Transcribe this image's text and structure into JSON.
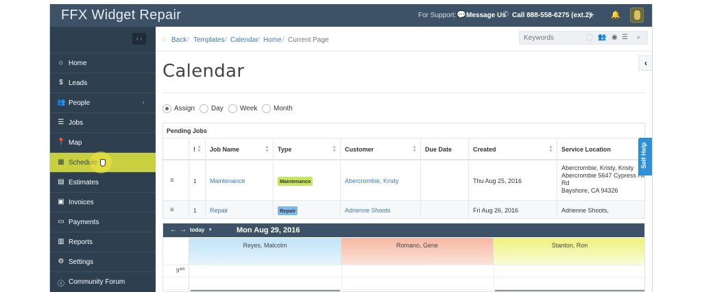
{
  "app": {
    "brand": "FFX Widget Repair"
  },
  "topbar": {
    "support_label": "For Support:",
    "message_label": "Message Us",
    "call_label": "Call 888-558-6275 (ext.2)",
    "plus_icon": "+",
    "bell_icon": "🔔"
  },
  "sidebar": {
    "toggle_label": "‹ ›",
    "items": [
      {
        "icon": "⌂",
        "label": "Home"
      },
      {
        "icon": "$",
        "label": "Leads"
      },
      {
        "icon": "👥",
        "label": "People",
        "chevron": "‹"
      },
      {
        "icon": "☰",
        "label": "Jobs"
      },
      {
        "icon": "📍",
        "label": "Map"
      },
      {
        "icon": "▦",
        "label": "Schedule"
      },
      {
        "icon": "▤",
        "label": "Estimates"
      },
      {
        "icon": "▣",
        "label": "Invoices"
      },
      {
        "icon": "▭",
        "label": "Payments"
      },
      {
        "icon": "▥",
        "label": "Reports"
      },
      {
        "icon": "⚙",
        "label": "Settings"
      },
      {
        "icon": "ⓘ",
        "label": "Community Forum"
      }
    ]
  },
  "breadcrumb": {
    "items": [
      "Back",
      "Templates",
      "Calendar",
      "Home"
    ],
    "current": "Current Page"
  },
  "search": {
    "placeholder": "Keywords"
  },
  "page": {
    "title": "Calendar"
  },
  "view_options": {
    "selected": "Assign",
    "options": [
      "Assign",
      "Day",
      "Week",
      "Month"
    ]
  },
  "pending_jobs": {
    "title": "Pending Jobs",
    "columns": [
      "!",
      "Job Name",
      "Type",
      "Customer",
      "Due Date",
      "Created",
      "Service Location"
    ],
    "rows": [
      {
        "priority": "1",
        "job_name": "Maintenance",
        "type": "Maintenance",
        "customer": "Abercrombie, Kristy",
        "due_date": "",
        "created": "Thu Aug 25, 2016",
        "location_1": "Abercrombie, Kristy, Kristy",
        "location_2": "Abercrombie 5647 Cypress Hill",
        "location_3": "Rd",
        "location_4": "Bayshore, CA 94326"
      },
      {
        "priority": "1",
        "job_name": "Repair",
        "type": "Repair",
        "customer": "Adrienne Shoots",
        "due_date": "",
        "created": "Fri Aug 26, 2016",
        "location_1": "Adrienne Shoots,"
      }
    ]
  },
  "calendar": {
    "today_label": "today",
    "date": "Mon Aug 29, 2016",
    "resources": [
      "Reyes, Malcolm",
      "Romano, Gene",
      "Stanton, Ron"
    ],
    "first_hour": "9",
    "first_hour_suffix": "am"
  },
  "self_help": {
    "label": "Self Help"
  },
  "colors": {
    "topbar": "#3d5266",
    "sidebar": "#2e3f50",
    "active_nav": "#c9d03f",
    "link": "#3a79b8",
    "self_help": "#2f8fd8"
  }
}
